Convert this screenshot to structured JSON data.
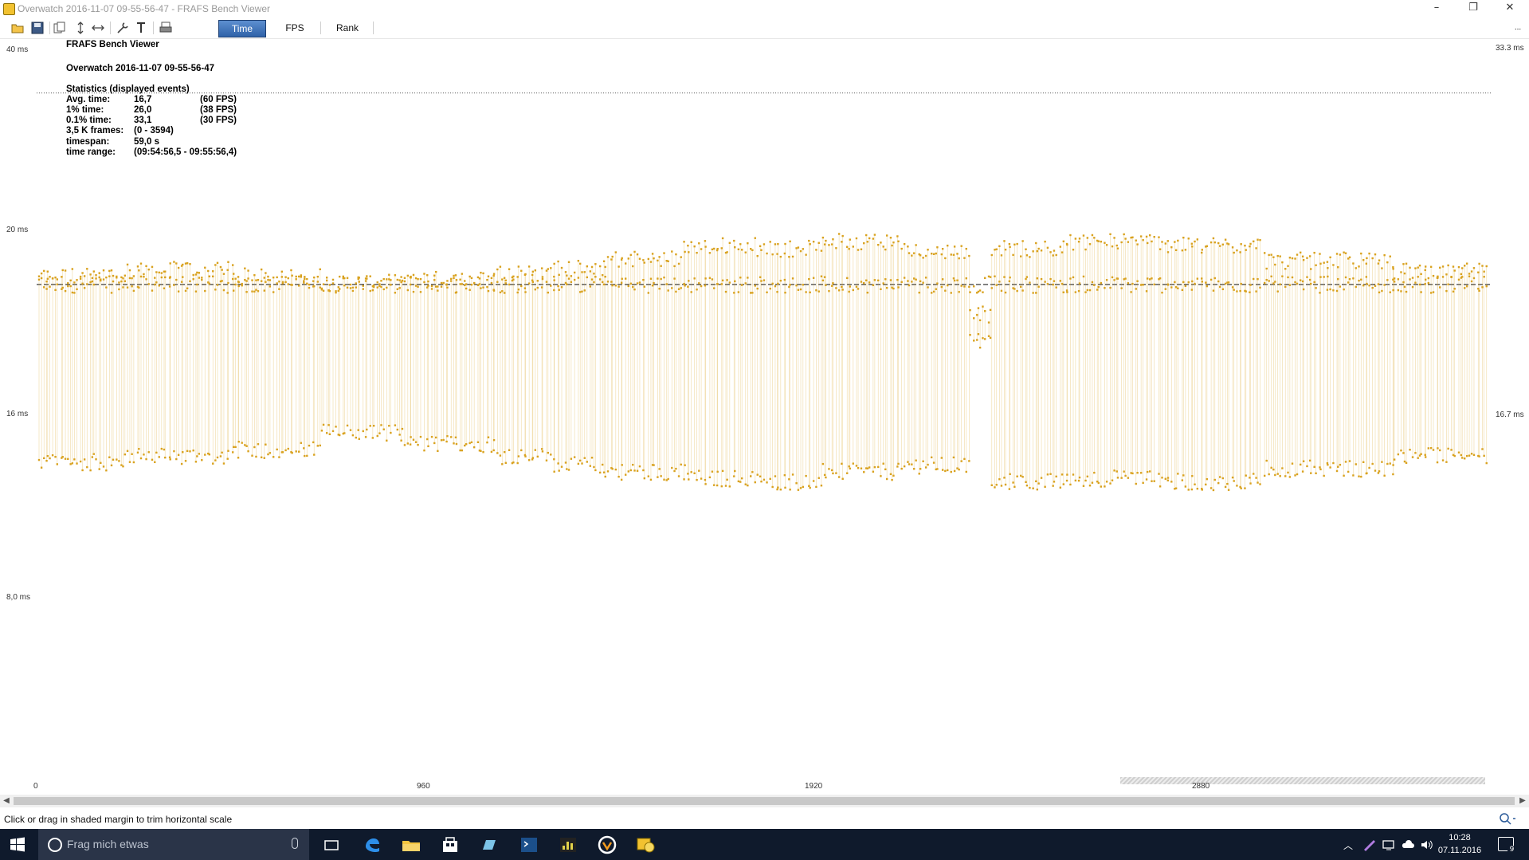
{
  "window": {
    "title": "Overwatch 2016-11-07 09-55-56-47 - FRAFS Bench Viewer",
    "controls": {
      "minimize": "–",
      "maximize": "❐",
      "close": "✕"
    }
  },
  "toolbar": {
    "icons": [
      "open-icon",
      "save-icon",
      "copy-icon",
      "fit-vertical-icon",
      "fit-horizontal-icon",
      "wrench-icon",
      "text-icon",
      "print-icon"
    ],
    "tabs": [
      {
        "label": "Time",
        "active": true
      },
      {
        "label": "FPS",
        "active": false
      },
      {
        "label": "Rank",
        "active": false
      }
    ],
    "overflow": "..."
  },
  "overlay": {
    "app_name": "FRAFS Bench Viewer",
    "file_name": "Overwatch 2016-11-07 09-55-56-47",
    "stats_header": "Statistics (displayed events)",
    "stats": [
      {
        "label": "Avg. time:",
        "value": "16,7",
        "extra": "(60 FPS)"
      },
      {
        "label": "1% time:",
        "value": "26,0",
        "extra": "(38 FPS)"
      },
      {
        "label": "0.1% time:",
        "value": "33,1",
        "extra": "(30 FPS)"
      },
      {
        "label": "3,5 K frames:",
        "value": "(0 - 3594)",
        "extra": ""
      },
      {
        "label": "timespan:",
        "value": "59,0 s",
        "extra": ""
      },
      {
        "label": "time range:",
        "value": "(09:54:56,5 - 09:55:56,4)",
        "extra": ""
      }
    ]
  },
  "chart_data": {
    "type": "scatter",
    "title": "",
    "xlabel": "",
    "ylabel": "",
    "y_scale": "log",
    "y_ticks": [
      "40 ms",
      "20 ms",
      "16 ms",
      "8,0 ms"
    ],
    "reference_lines": [
      {
        "label": "33.3 ms",
        "value": 33.3,
        "style": "dotted"
      },
      {
        "label": "16.7 ms",
        "value": 16.7,
        "style": "dashed"
      }
    ],
    "x_ticks": [
      "0",
      "960",
      "1920",
      "2880"
    ],
    "xlim": [
      0,
      3594
    ],
    "series_color": "#d9a21f",
    "segments": [
      {
        "x_from": 0,
        "x_to": 220,
        "high": 17.2,
        "low": 8.8
      },
      {
        "x_from": 220,
        "x_to": 480,
        "high": 17.6,
        "low": 9.0
      },
      {
        "x_from": 480,
        "x_to": 700,
        "high": 17.2,
        "low": 9.2
      },
      {
        "x_from": 700,
        "x_to": 900,
        "high": 16.8,
        "low": 9.8
      },
      {
        "x_from": 900,
        "x_to": 1130,
        "high": 17.0,
        "low": 9.4
      },
      {
        "x_from": 1130,
        "x_to": 1280,
        "high": 17.4,
        "low": 9.0
      },
      {
        "x_from": 1280,
        "x_to": 1400,
        "high": 17.7,
        "low": 8.7
      },
      {
        "x_from": 1400,
        "x_to": 1600,
        "high": 18.3,
        "low": 8.5
      },
      {
        "x_from": 1600,
        "x_to": 1780,
        "high": 19.2,
        "low": 8.3
      },
      {
        "x_from": 1780,
        "x_to": 1940,
        "high": 19.0,
        "low": 8.2
      },
      {
        "x_from": 1940,
        "x_to": 2150,
        "high": 19.5,
        "low": 8.5
      },
      {
        "x_from": 2150,
        "x_to": 2310,
        "high": 18.8,
        "low": 8.7
      },
      {
        "x_from": 2310,
        "x_to": 2360,
        "high": 15.0,
        "low": 13.6
      },
      {
        "x_from": 2360,
        "x_to": 2550,
        "high": 19.0,
        "low": 8.2
      },
      {
        "x_from": 2550,
        "x_to": 2800,
        "high": 19.5,
        "low": 8.3
      },
      {
        "x_from": 2800,
        "x_to": 3040,
        "high": 19.2,
        "low": 8.2
      },
      {
        "x_from": 3040,
        "x_to": 3360,
        "high": 18.2,
        "low": 8.6
      },
      {
        "x_from": 3360,
        "x_to": 3594,
        "high": 17.5,
        "low": 9.0
      }
    ],
    "mean_value": 16.7,
    "y_range_ms": [
      6.0,
      40.0
    ]
  },
  "status": {
    "text": "Click or drag in shaded margin to trim horizontal scale",
    "zoom_icon": "zoom-icon"
  },
  "taskbar": {
    "search_placeholder": "Frag mich etwas",
    "apps": [
      "task-view-icon",
      "edge-icon",
      "explorer-icon",
      "store-icon",
      "app-icon",
      "terminal-icon",
      "stats-icon",
      "overwatch-icon",
      "frafs-icon"
    ],
    "time": "10:28",
    "date": "07.11.2016",
    "notification_count": "9"
  }
}
